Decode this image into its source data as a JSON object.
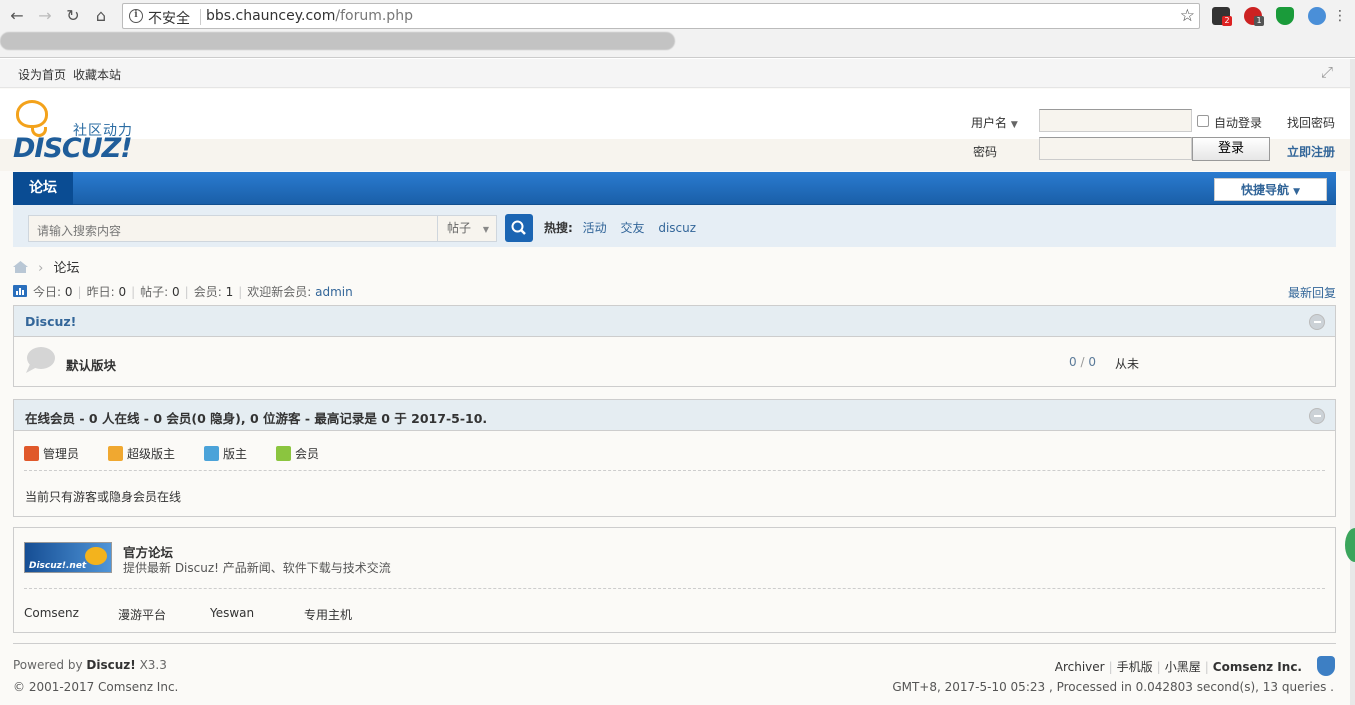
{
  "browser": {
    "insecure": "不安全",
    "url_host": "bbs.chauncey.com",
    "url_path": "/forum.php",
    "ext_badges": [
      "2",
      "1"
    ]
  },
  "topbar": {
    "set_home": "设为首页",
    "bookmark": "收藏本站"
  },
  "logo": {
    "cn": "社区动力",
    "en": "DISCUZ!"
  },
  "login": {
    "username_label": "用户名",
    "password_label": "密码",
    "auto_login": "自动登录",
    "forgot": "找回密码",
    "login_button": "登录",
    "register": "立即注册"
  },
  "nav": {
    "current": "论坛",
    "quick_nav": "快捷导航"
  },
  "search": {
    "placeholder": "请输入搜索内容",
    "type": "帖子",
    "hot_label": "热搜:",
    "hot": [
      "活动",
      "交友",
      "discuz"
    ]
  },
  "breadcrumb": {
    "current": "论坛"
  },
  "stats": {
    "today_label": "今日:",
    "today": "0",
    "yesterday_label": "昨日:",
    "yesterday": "0",
    "posts_label": "帖子:",
    "posts": "0",
    "members_label": "会员:",
    "members": "1",
    "welcome_label": "欢迎新会员:",
    "newest": "admin",
    "latest_reply": "最新回复"
  },
  "category": {
    "title": "Discuz!",
    "forum_name": "默认版块",
    "threads": "0",
    "posts": "0",
    "slash": "/",
    "last": "从未"
  },
  "online": {
    "title": "在线会员 - 0 人在线 - 0 会员(0 隐身), 0 位游客 - 最高记录是 0 于 2017-5-10.",
    "groups": [
      "管理员",
      "超级版主",
      "版主",
      "会员"
    ],
    "message": "当前只有游客或隐身会员在线"
  },
  "links": {
    "logo_text": "Discuz!.net",
    "title": "官方论坛",
    "desc": "提供最新 Discuz! 产品新闻、软件下载与技术交流",
    "items": [
      "Comsenz",
      "漫游平台",
      "Yeswan",
      "专用主机"
    ]
  },
  "footer": {
    "powered": "Powered by",
    "brand": "Discuz!",
    "version": "X3.3",
    "copyright": "© 2001-2017 Comsenz Inc.",
    "archiver": "Archiver",
    "mobile": "手机版",
    "blackroom": "小黑屋",
    "company": "Comsenz Inc.",
    "processed": "GMT+8, 2017-5-10 05:23 , Processed in 0.042803 second(s), 13 queries ."
  }
}
